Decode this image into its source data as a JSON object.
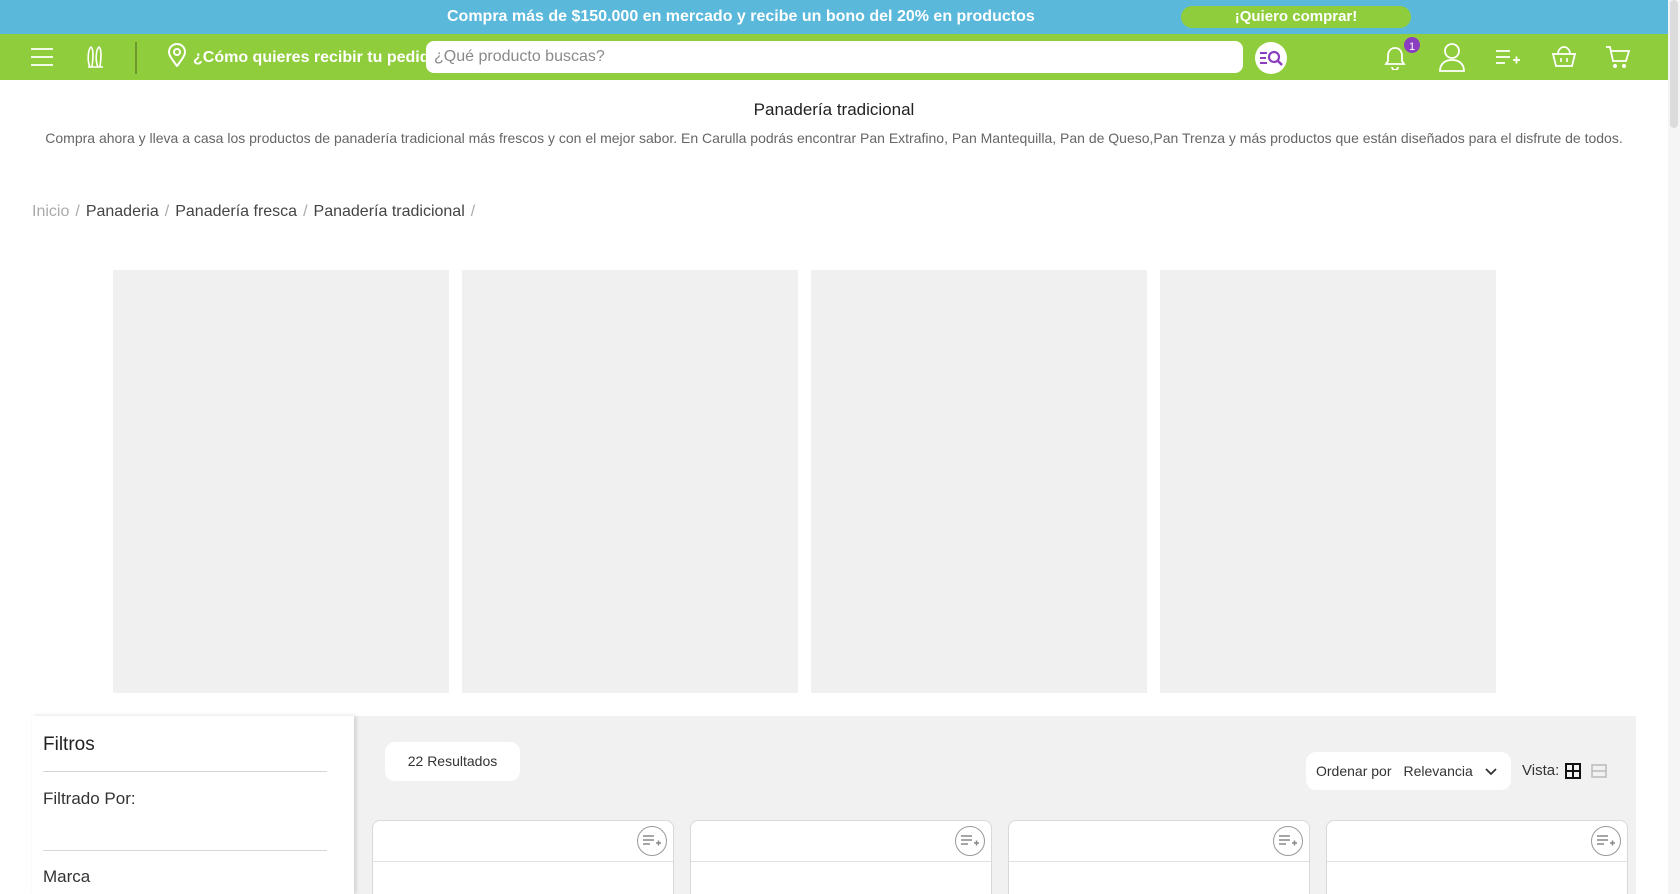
{
  "promo": {
    "text": "Compra más de $150.000 en mercado y recibe un bono del 20% en productos",
    "button": "¡Quiero comprar!"
  },
  "header": {
    "delivery_text": "¿Cómo quieres recibir tu pedido?",
    "search_placeholder": "¿Qué producto buscas?",
    "notification_count": "1",
    "icons": [
      "menu-icon",
      "brand-logo-icon",
      "location-pin-icon",
      "search-list-icon",
      "bell-icon",
      "user-icon",
      "add-list-icon",
      "basket-icon",
      "cart-icon"
    ]
  },
  "category": {
    "title": "Panadería tradicional",
    "description": "Compra ahora y lleva a casa los productos de panadería tradicional más frescos y con el mejor sabor. En Carulla podrás encontrar Pan Extrafino, Pan Mantequilla, Pan de Queso,Pan Trenza y más productos que están diseñados para el disfrute de todos."
  },
  "breadcrumb": [
    {
      "label": "Inicio"
    },
    {
      "label": "Panaderia"
    },
    {
      "label": "Panadería fresca"
    },
    {
      "label": "Panadería tradicional"
    }
  ],
  "breadcrumb_separator": "/",
  "filters": {
    "title": "Filtros",
    "filtered_by": "Filtrado Por:",
    "brand": "Marca"
  },
  "results": {
    "count_label": "22 Resultados",
    "sort_label": "Ordenar por",
    "sort_value": "Relevancia",
    "view_label": "Vista:"
  },
  "colors": {
    "promo_bar": "#5ab8db",
    "header": "#8fcd3c",
    "badge": "#8b3fc0",
    "placeholder_gray": "#f0f0f0"
  }
}
